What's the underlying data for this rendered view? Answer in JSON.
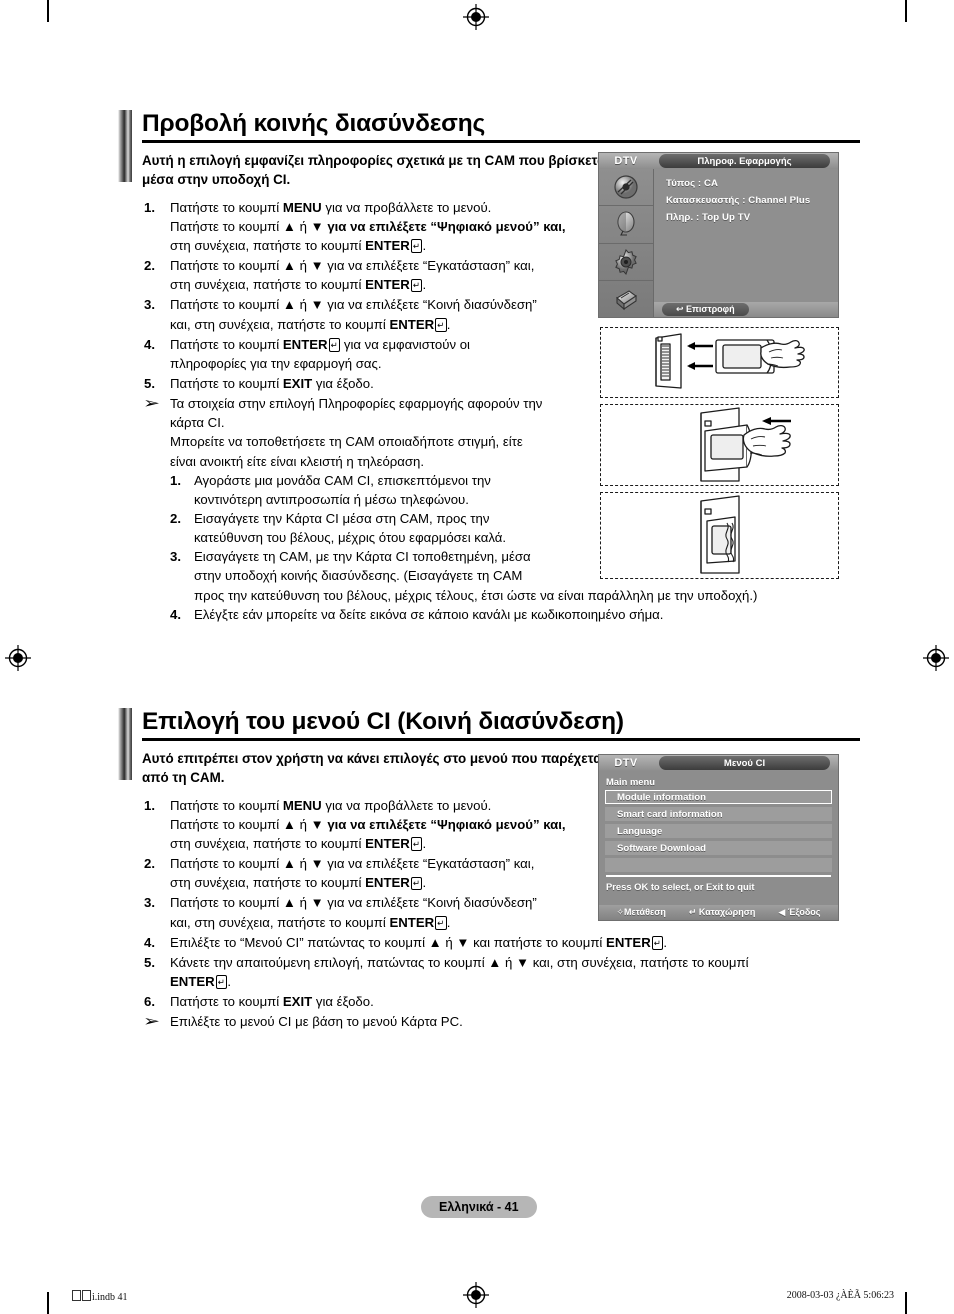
{
  "page": {
    "footer_label": "Ελληνικά - 41",
    "imprint_left": "i.indb   41",
    "imprint_right": "2008-03-03   ¿ÀÈÃ 5:06:23"
  },
  "section1": {
    "title": "Προβολή κοινής διασύνδεσης",
    "lead": "Αυτή η επιλογή εμφανίζει πληροφορίες σχετικά με τη CAM που βρίσκεται μέσα στην υποδοχή CI.",
    "steps": [
      {
        "num": "1.",
        "parts": [
          {
            "t": "Πατήστε το κουμπί ",
            "b": false
          },
          {
            "t": "MENU",
            "b": true
          },
          {
            "t": " για να προβάλλετε το μενού.",
            "b": false
          },
          {
            "t": "BR",
            "b": false
          },
          {
            "t": "Πατήστε το κουμπί ▲ ή ▼ ",
            "b": false
          },
          {
            "t": "για να επιλέξετε “Ψηφιακό μενού” και,",
            "b": true
          },
          {
            "t": "BR",
            "b": false
          },
          {
            "t": "στη συνέχεια, πατήστε το κουμπί ",
            "b": false
          },
          {
            "t": "ENTER",
            "b": true
          },
          {
            "t": "ENT",
            "b": false
          },
          {
            "t": ".",
            "b": false
          }
        ]
      },
      {
        "num": "2.",
        "parts": [
          {
            "t": "Πατήστε το κουμπί ▲ ή ▼ για να επιλέξετε “Εγκατάσταση” και,",
            "b": false
          },
          {
            "t": "BR",
            "b": false
          },
          {
            "t": "στη συνέχεια, πατήστε το κουμπί ",
            "b": false
          },
          {
            "t": "ENTER",
            "b": true
          },
          {
            "t": "ENT",
            "b": false
          },
          {
            "t": ".",
            "b": false
          }
        ]
      },
      {
        "num": "3.",
        "parts": [
          {
            "t": "Πατήστε το κουμπί ▲ ή ▼ για να επιλέξετε “Κοινή διασύνδεση”",
            "b": false
          },
          {
            "t": "BR",
            "b": false
          },
          {
            "t": "και, στη συνέχεια, πατήστε το κουμπί ",
            "b": false
          },
          {
            "t": "ENTER",
            "b": true
          },
          {
            "t": "ENT",
            "b": false
          },
          {
            "t": ".",
            "b": false
          }
        ]
      },
      {
        "num": "4.",
        "parts": [
          {
            "t": "Πατήστε το κουμπί ",
            "b": false
          },
          {
            "t": "ENTER",
            "b": true
          },
          {
            "t": "ENT",
            "b": false
          },
          {
            "t": " για να εμφανιστούν οι",
            "b": false
          },
          {
            "t": "BR",
            "b": false
          },
          {
            "t": "πληροφορίες για την εφαρμογή σας.",
            "b": false
          }
        ]
      },
      {
        "num": "5.",
        "parts": [
          {
            "t": "Πατήστε το κουμπί ",
            "b": false
          },
          {
            "t": "EXIT",
            "b": true
          },
          {
            "t": " για έξοδο.",
            "b": false
          }
        ]
      }
    ],
    "note_lines": [
      "Τα στοιχεία στην επιλογή Πληροφορίες εφαρμογής αφορούν την",
      "κάρτα CI.",
      "Μπορείτε να τοποθετήσετε τη CAM οποιαδήποτε στιγμή, είτε",
      "είναι ανοικτή είτε είναι κλειστή η τηλεόραση."
    ],
    "subs": [
      {
        "num": "1.",
        "lines": [
          "Αγοράστε μια μονάδα CAM CI, επισκεπτόμενοι την",
          "κοντινότερη αντιπροσωπία ή μέσω τηλεφώνου."
        ]
      },
      {
        "num": "2.",
        "lines": [
          "Εισαγάγετε την Κάρτα CI μέσα στη CAM, προς την",
          "κατεύθυνση του βέλους, μέχρις ότου εφαρμόσει καλά."
        ]
      },
      {
        "num": "3.",
        "lines": [
          "Εισαγάγετε τη CAM, με την Κάρτα CI τοποθετημένη, μέσα",
          "στην υποδοχή κοινής διασύνδεσης. (Εισαγάγετε τη CAM",
          "προς την κατεύθυνση του βέλους, μέχρις τέλους, έτσι ώστε να είναι παράλληλη με την υποδοχή.)"
        ]
      },
      {
        "num": "4.",
        "lines": [
          "Ελέγξτε εάν μπορείτε να δείτε εικόνα σε κάποιο κανάλι με κωδικοποιημένο σήμα."
        ]
      }
    ]
  },
  "section2": {
    "title": "Επιλογή του μενού CI (Κοινή διασύνδεση)",
    "lead": "Αυτό επιτρέπει στον χρήστη να κάνει επιλογές στο μενού που παρέχεται από τη CAM.",
    "steps": [
      {
        "num": "1.",
        "parts": [
          {
            "t": "Πατήστε το κουμπί ",
            "b": false
          },
          {
            "t": "MENU",
            "b": true
          },
          {
            "t": " για να προβάλλετε το μενού.",
            "b": false
          },
          {
            "t": "BR",
            "b": false
          },
          {
            "t": "Πατήστε το κουμπί ▲ ή ▼ ",
            "b": false
          },
          {
            "t": "για να επιλέξετε “Ψηφιακό μενού” και,",
            "b": true
          },
          {
            "t": "BR",
            "b": false
          },
          {
            "t": "στη συνέχεια, πατήστε το κουμπί ",
            "b": false
          },
          {
            "t": "ENTER",
            "b": true
          },
          {
            "t": "ENT",
            "b": false
          },
          {
            "t": ".",
            "b": false
          }
        ]
      },
      {
        "num": "2.",
        "parts": [
          {
            "t": "Πατήστε το κουμπί ▲ ή ▼ για να επιλέξετε “Εγκατάσταση” και,",
            "b": false
          },
          {
            "t": "BR",
            "b": false
          },
          {
            "t": "στη συνέχεια, πατήστε το κουμπί ",
            "b": false
          },
          {
            "t": "ENTER",
            "b": true
          },
          {
            "t": "ENT",
            "b": false
          },
          {
            "t": ".",
            "b": false
          }
        ]
      },
      {
        "num": "3.",
        "parts": [
          {
            "t": "Πατήστε το κουμπί ▲ ή ▼ για να επιλέξετε “Κοινή διασύνδεση”",
            "b": false
          },
          {
            "t": "BR",
            "b": false
          },
          {
            "t": "και, στη συνέχεια, πατήστε το κουμπί ",
            "b": false
          },
          {
            "t": "ENTER",
            "b": true
          },
          {
            "t": "ENT",
            "b": false
          },
          {
            "t": ".",
            "b": false
          }
        ]
      },
      {
        "num": "4.",
        "parts": [
          {
            "t": "Επιλέξτε το “Μενού CI” πατώντας το κουμπί ▲ ή ▼ και πατήστε το κουμπί ",
            "b": false
          },
          {
            "t": "ENTER",
            "b": true
          },
          {
            "t": "ENT",
            "b": false
          },
          {
            "t": ".",
            "b": false
          }
        ]
      },
      {
        "num": "5.",
        "parts": [
          {
            "t": "Κάνετε την απαιτούμενη επιλογή, πατώντας το κουμπί ▲ ή ▼ και, στη συνέχεια, πατήστε το κουμπί",
            "b": false
          },
          {
            "t": "BR",
            "b": false
          },
          {
            "t": "ENTER",
            "b": true
          },
          {
            "t": "ENT",
            "b": false
          },
          {
            "t": ".",
            "b": false
          }
        ]
      },
      {
        "num": "6.",
        "parts": [
          {
            "t": "Πατήστε το κουμπί ",
            "b": false
          },
          {
            "t": "EXIT",
            "b": true
          },
          {
            "t": " για έξοδο.",
            "b": false
          }
        ]
      }
    ],
    "note_lines": [
      "Επιλέξτε το μενού CI με βάση το μενού Κάρτα PC."
    ]
  },
  "osd_app_info": {
    "source_label": "DTV",
    "tab_label": "Πληροφ. Εφαρμογής",
    "lines": [
      "Τύπος : CA",
      "Κατασκευαστής : Channel Plus",
      "Πληρ. : Top Up TV"
    ],
    "return_label": "↩ Επιστροφή",
    "icons": [
      "antenna-icon",
      "satellite-dish-icon",
      "gear-setup-icon",
      "input-source-icon"
    ]
  },
  "osd_ci_menu": {
    "source_label": "DTV",
    "tab_label": "Μενού CI",
    "main_menu_label": "Main menu",
    "items": [
      {
        "label": "Module information",
        "selected": true
      },
      {
        "label": "Smart card information",
        "selected": false
      },
      {
        "label": "Language",
        "selected": false
      },
      {
        "label": "Software Download",
        "selected": false
      },
      {
        "label": "",
        "selected": false
      }
    ],
    "hint": "Press OK to select, or Exit to quit",
    "footer": [
      "✧Μετάθεση",
      "↵ Καταχώρηση",
      "◀ Έξοδος"
    ]
  },
  "illustrations": [
    {
      "name": "cam-insert-card-step",
      "caption": ""
    },
    {
      "name": "cam-insert-slot-step",
      "caption": ""
    },
    {
      "name": "cam-seated-step",
      "caption": ""
    }
  ],
  "colors": {
    "osd_bg": "#8f8f8f",
    "osd_text": "#ffffff",
    "page_pill": "#b6b6b6",
    "rule": "#000000"
  }
}
